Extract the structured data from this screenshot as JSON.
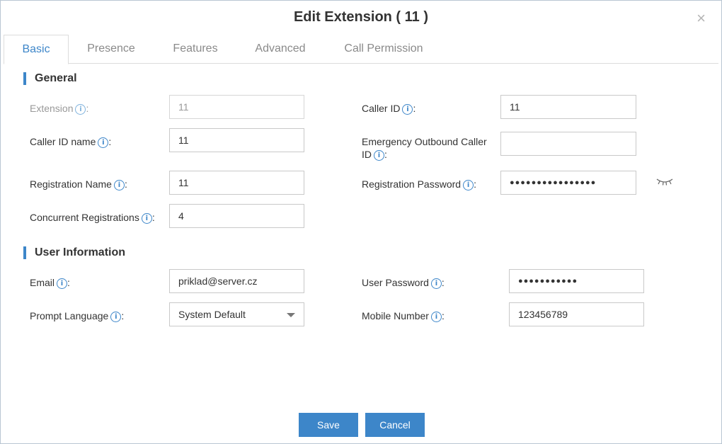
{
  "dialog": {
    "title": "Edit Extension ( 11 )",
    "close": "×"
  },
  "tabs": [
    "Basic",
    "Presence",
    "Features",
    "Advanced",
    "Call Permission"
  ],
  "sections": {
    "general": "General",
    "user_info": "User Information"
  },
  "fields": {
    "extension": {
      "label": "Extension",
      "value": "11"
    },
    "caller_id": {
      "label": "Caller ID",
      "value": "11"
    },
    "caller_id_name": {
      "label": "Caller ID name",
      "value": "11"
    },
    "emergency_caller_id": {
      "label_line1": "Emergency Outbound Caller",
      "label_line2": "ID",
      "value": ""
    },
    "registration_name": {
      "label": "Registration Name",
      "value": "11"
    },
    "registration_password": {
      "label": "Registration Password",
      "value": "●●●●●●●●●●●●●●●●"
    },
    "concurrent_registrations": {
      "label": "Concurrent Registrations",
      "value": "4"
    },
    "email": {
      "label": "Email",
      "value": "priklad@server.cz"
    },
    "user_password": {
      "label": "User Password",
      "value": "●●●●●●●●●●●"
    },
    "prompt_language": {
      "label": "Prompt Language",
      "value": "System Default"
    },
    "mobile_number": {
      "label": "Mobile Number",
      "value": "123456789"
    }
  },
  "info_glyph": "i",
  "colon": ":",
  "buttons": {
    "save": "Save",
    "cancel": "Cancel"
  },
  "colors": {
    "accent": "#3d86c9"
  },
  "icons": {
    "info": "info-icon",
    "close": "close-icon",
    "eye": "eye-closed-icon",
    "dropdown": "chevron-down-icon"
  }
}
